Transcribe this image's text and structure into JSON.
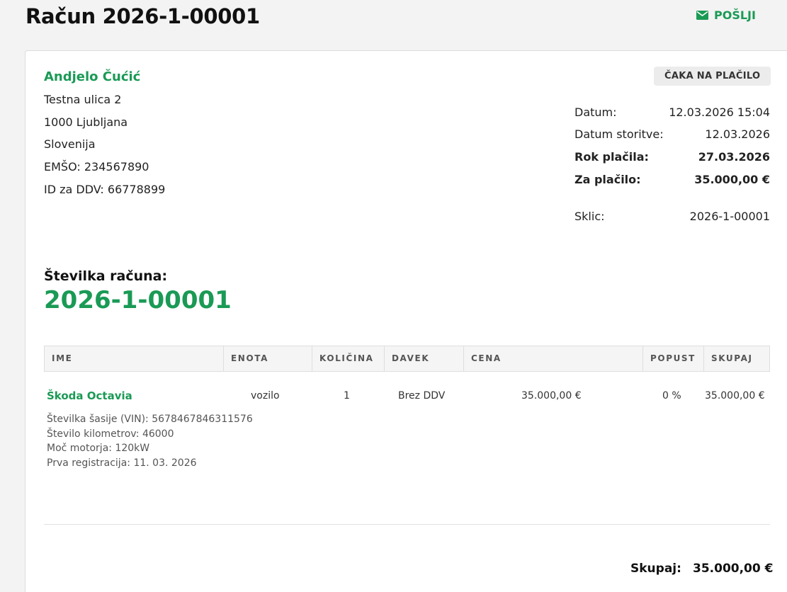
{
  "header": {
    "title": "Račun 2026-1-00001",
    "send_label": "POŠLJI",
    "send_icon": "envelope-icon"
  },
  "customer": {
    "name": "Andjelo Čućić",
    "lines": [
      "Testna ulica 2",
      "1000 Ljubljana",
      "Slovenija",
      "EMŠO: 234567890",
      "ID za DDV: 66778899"
    ]
  },
  "status": "ČAKA NA PLAČILO",
  "meta": [
    {
      "label": "Datum:",
      "value": "12.03.2026 15:04",
      "bold": false
    },
    {
      "label": "Datum storitve:",
      "value": "12.03.2026",
      "bold": false
    },
    {
      "label": "Rok plačila:",
      "value": "27.03.2026",
      "bold": true
    },
    {
      "label": "Za plačilo:",
      "value": "35.000,00 €",
      "bold": true
    },
    {
      "label": "Sklic:",
      "value": "2026-1-00001",
      "bold": false
    }
  ],
  "invoice_number": {
    "label": "Številka računa:",
    "value": "2026-1-00001"
  },
  "table": {
    "columns": [
      "IME",
      "ENOTA",
      "KOLIČINA",
      "DAVEK",
      "CENA",
      "POPUST",
      "SKUPAJ"
    ],
    "row": {
      "name": "Škoda Octavia",
      "unit": "vozilo",
      "qty": "1",
      "tax": "Brez DDV",
      "price": "35.000,00 €",
      "discount": "0 %",
      "total": "35.000,00 €",
      "description": [
        "Številka šasije (VIN): 5678467846311576",
        "Število kilometrov: 46000",
        "Moč motorja: 120kW",
        "Prva registracija: 11. 03. 2026"
      ]
    }
  },
  "totals": {
    "label": "Skupaj:",
    "value": "35.000,00 €"
  },
  "colors": {
    "accent": "#1a9a55",
    "background": "#f3f3f3",
    "badge": "#ececec"
  }
}
